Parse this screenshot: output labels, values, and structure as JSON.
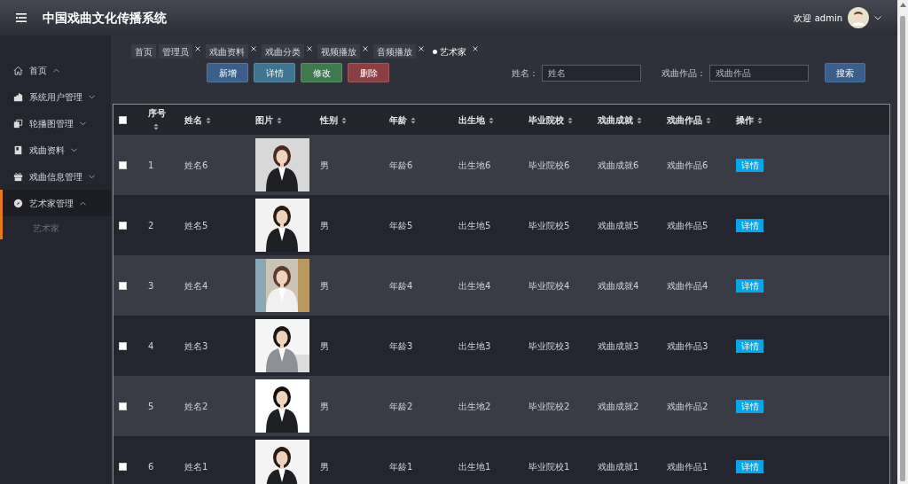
{
  "header": {
    "title": "中国戏曲文化传播系统",
    "welcome": "欢迎 admin"
  },
  "sidebar": {
    "items": [
      {
        "label": "首页",
        "expanded": true,
        "selected": false
      },
      {
        "label": "系统用户管理",
        "expanded": false,
        "selected": false
      },
      {
        "label": "轮播图管理",
        "expanded": false,
        "selected": false
      },
      {
        "label": "戏曲资料",
        "expanded": false,
        "selected": false
      },
      {
        "label": "戏曲信息管理",
        "expanded": false,
        "selected": false
      },
      {
        "label": "艺术家管理",
        "expanded": true,
        "selected": true,
        "children": [
          {
            "label": "艺术家"
          }
        ]
      }
    ]
  },
  "tabs": [
    {
      "label": "首页",
      "closable": false,
      "selected": false
    },
    {
      "label": "管理员",
      "closable": true,
      "selected": false
    },
    {
      "label": "戏曲资料",
      "closable": true,
      "selected": false
    },
    {
      "label": "戏曲分类",
      "closable": true,
      "selected": false
    },
    {
      "label": "视频播放",
      "closable": true,
      "selected": false
    },
    {
      "label": "音频播放",
      "closable": true,
      "selected": false
    },
    {
      "label": "艺术家",
      "closable": true,
      "selected": true
    }
  ],
  "toolbar": {
    "buttons": [
      {
        "label": "新增",
        "kind": "add"
      },
      {
        "label": "详情",
        "kind": "detail"
      },
      {
        "label": "修改",
        "kind": "edit"
      },
      {
        "label": "删除",
        "kind": "delete"
      }
    ],
    "filters": [
      {
        "label": "姓名：",
        "placeholder": "姓名"
      },
      {
        "label": "戏曲作品：",
        "placeholder": "戏曲作品"
      }
    ],
    "search_button": "搜索"
  },
  "table": {
    "all_checked": false,
    "columns": [
      "序号",
      "姓名",
      "图片",
      "性别",
      "年龄",
      "出生地",
      "毕业院校",
      "戏曲成就",
      "戏曲作品",
      "操作"
    ],
    "rows": [
      {
        "checked": false,
        "cells": [
          "1",
          "姓名6",
          {
            "kind": "picture"
          },
          "男",
          "年龄6",
          "出生地6",
          "毕业院校6",
          "戏曲成就6",
          "戏曲作品6"
        ],
        "action": "详情"
      },
      {
        "checked": false,
        "cells": [
          "2",
          "姓名5",
          {
            "kind": "picture"
          },
          "男",
          "年龄5",
          "出生地5",
          "毕业院校5",
          "戏曲成就5",
          "戏曲作品5"
        ],
        "action": "详情"
      },
      {
        "checked": false,
        "cells": [
          "3",
          "姓名4",
          {
            "kind": "picture"
          },
          "男",
          "年龄4",
          "出生地4",
          "毕业院校4",
          "戏曲成就4",
          "戏曲作品4"
        ],
        "action": "详情"
      },
      {
        "checked": false,
        "cells": [
          "4",
          "姓名3",
          {
            "kind": "picture"
          },
          "男",
          "年龄3",
          "出生地3",
          "毕业院校3",
          "戏曲成就3",
          "戏曲作品3"
        ],
        "action": "详情"
      },
      {
        "checked": false,
        "cells": [
          "5",
          "姓名2",
          {
            "kind": "picture"
          },
          "男",
          "年龄2",
          "出生地2",
          "毕业院校2",
          "戏曲成就2",
          "戏曲作品2"
        ],
        "action": "详情"
      },
      {
        "checked": false,
        "cells": [
          "6",
          "姓名1",
          {
            "kind": "picture"
          },
          "男",
          "年龄1",
          "出生地1",
          "毕业院校1",
          "戏曲成就1",
          "戏曲作品1"
        ],
        "action": "详情"
      }
    ]
  }
}
